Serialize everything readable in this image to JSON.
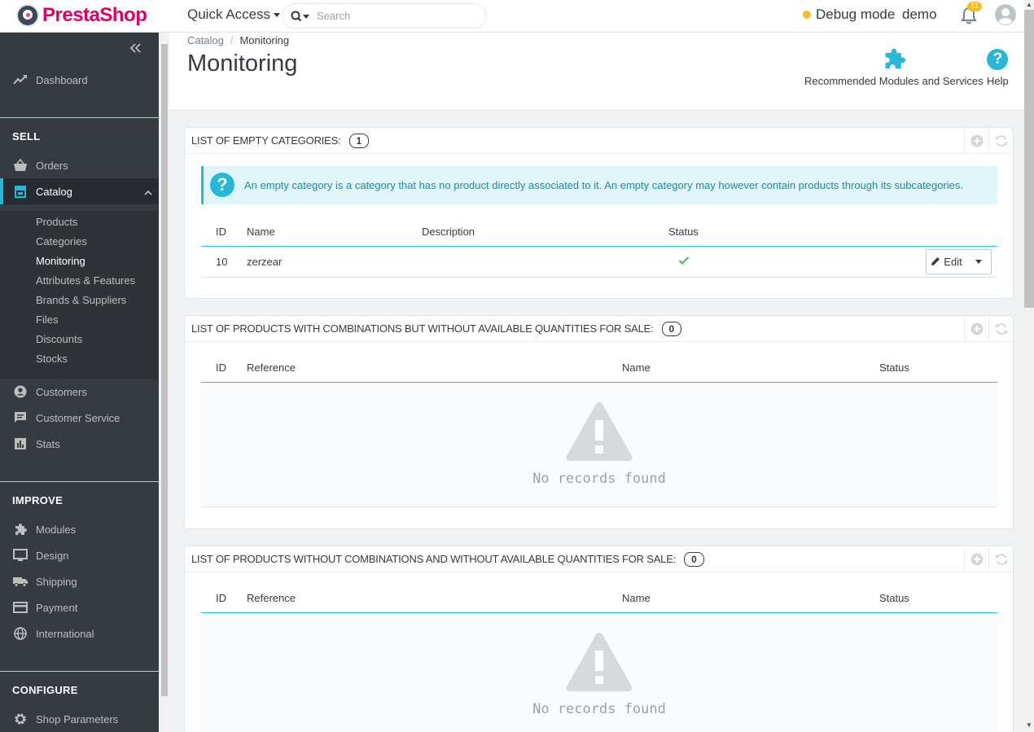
{
  "header": {
    "brand": "PrestaShop",
    "quick_access": "Quick Access",
    "search_placeholder": "Search",
    "debug_mode": "Debug mode",
    "user": "demo",
    "notifications_count": "11"
  },
  "sidebar": {
    "dashboard": "Dashboard",
    "sell": "SELL",
    "orders": "Orders",
    "catalog": "Catalog",
    "catalog_sub": [
      "Products",
      "Categories",
      "Monitoring",
      "Attributes & Features",
      "Brands & Suppliers",
      "Files",
      "Discounts",
      "Stocks"
    ],
    "customers": "Customers",
    "customer_service": "Customer Service",
    "stats": "Stats",
    "improve": "IMPROVE",
    "modules": "Modules",
    "design": "Design",
    "shipping": "Shipping",
    "payment": "Payment",
    "international": "International",
    "configure": "CONFIGURE",
    "shop_parameters": "Shop Parameters"
  },
  "page": {
    "breadcrumb_parent": "Catalog",
    "breadcrumb_sep": "/",
    "breadcrumb_current": "Monitoring",
    "title": "Monitoring",
    "recommended": "Recommended Modules and Services",
    "help": "Help"
  },
  "panel1": {
    "title": "List of empty categories:",
    "count": "1",
    "alert": "An empty category is a category that has no product directly associated to it. An empty category may however contain products through its subcategories.",
    "columns": [
      "ID",
      "Name",
      "Description",
      "Status"
    ],
    "rows": [
      {
        "id": "10",
        "name": "zerzear",
        "description": "",
        "status": "enabled"
      }
    ],
    "edit": "Edit"
  },
  "panel2": {
    "title": "List of products with combinations but without available quantities for sale:",
    "count": "0",
    "columns": [
      "ID",
      "Reference",
      "Name",
      "Status"
    ],
    "empty": "No records found"
  },
  "panel3": {
    "title": "List of products without combinations and without available quantities for sale:",
    "count": "0",
    "columns": [
      "ID",
      "Reference",
      "Name",
      "Status"
    ],
    "empty": "No records found"
  },
  "colors": {
    "accent": "#25b9d7",
    "sidebar_bg": "#363a41",
    "brand": "#df0067",
    "success": "#70b580",
    "warning": "#fbbb22"
  }
}
